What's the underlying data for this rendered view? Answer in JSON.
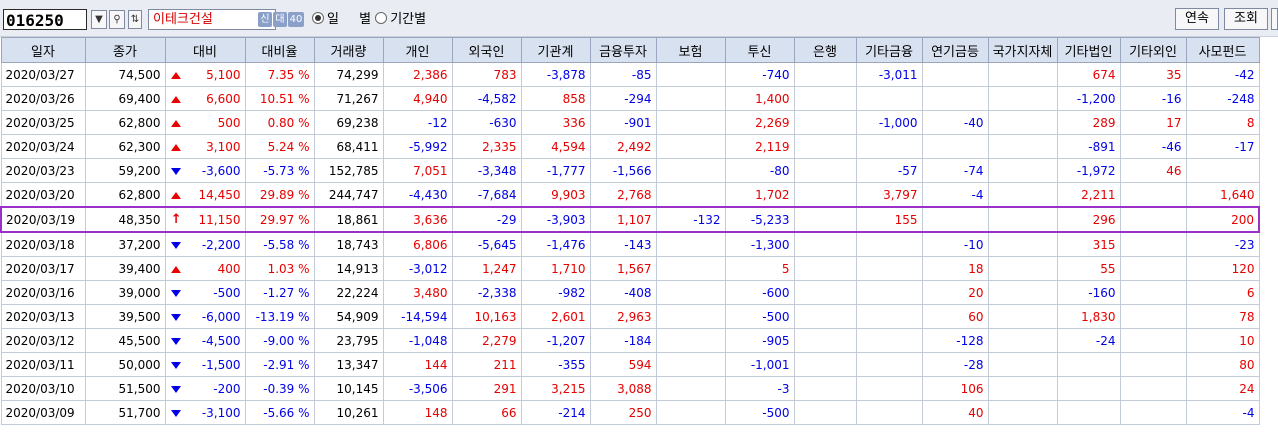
{
  "toolbar": {
    "stock_code": "016250",
    "stock_name": "이테크건설",
    "badge_credit": "신",
    "badge_loan": "대",
    "badge_margin": "40",
    "radio_daily": "일",
    "radio_separator": "별",
    "radio_period": "기간별",
    "continuous_label": "연속",
    "search_label": "조회"
  },
  "columns": [
    "일자",
    "종가",
    "대비",
    "대비율",
    "거래량",
    "개인",
    "외국인",
    "기관계",
    "금융투자",
    "보험",
    "투신",
    "은행",
    "기타금융",
    "연기금등",
    "국가지자체",
    "기타법인",
    "기타외인",
    "사모펀드"
  ],
  "colors": {
    "up": "#e60000",
    "down": "#0000e6",
    "selected_row_border": "#9b30c8",
    "header_bg": "#d8e1f0"
  },
  "rows": [
    {
      "date": "2020/03/27",
      "close": "74,500",
      "dir": "up",
      "chg": "5,100",
      "rate": "7.35 %",
      "vol": "74,299",
      "ind": "2,386",
      "frn": "783",
      "inst": "-3,878",
      "fin": "-85",
      "ins": "",
      "trust": "-740",
      "bank": "",
      "ofin": "-3,011",
      "pens": "",
      "gov": "",
      "ocorp": "674",
      "ofrn": "35",
      "pef": "-42"
    },
    {
      "date": "2020/03/26",
      "close": "69,400",
      "dir": "up",
      "chg": "6,600",
      "rate": "10.51 %",
      "vol": "71,267",
      "ind": "4,940",
      "frn": "-4,582",
      "inst": "858",
      "fin": "-294",
      "ins": "",
      "trust": "1,400",
      "bank": "",
      "ofin": "",
      "pens": "",
      "gov": "",
      "ocorp": "-1,200",
      "ofrn": "-16",
      "pef": "-248"
    },
    {
      "date": "2020/03/25",
      "close": "62,800",
      "dir": "up",
      "chg": "500",
      "rate": "0.80 %",
      "vol": "69,238",
      "ind": "-12",
      "frn": "-630",
      "inst": "336",
      "fin": "-901",
      "ins": "",
      "trust": "2,269",
      "bank": "",
      "ofin": "-1,000",
      "pens": "-40",
      "gov": "",
      "ocorp": "289",
      "ofrn": "17",
      "pef": "8"
    },
    {
      "date": "2020/03/24",
      "close": "62,300",
      "dir": "up",
      "chg": "3,100",
      "rate": "5.24 %",
      "vol": "68,411",
      "ind": "-5,992",
      "frn": "2,335",
      "inst": "4,594",
      "fin": "2,492",
      "ins": "",
      "trust": "2,119",
      "bank": "",
      "ofin": "",
      "pens": "",
      "gov": "",
      "ocorp": "-891",
      "ofrn": "-46",
      "pef": "-17"
    },
    {
      "date": "2020/03/23",
      "close": "59,200",
      "dir": "down",
      "chg": "-3,600",
      "rate": "-5.73 %",
      "vol": "152,785",
      "ind": "7,051",
      "frn": "-3,348",
      "inst": "-1,777",
      "fin": "-1,566",
      "ins": "",
      "trust": "-80",
      "bank": "",
      "ofin": "-57",
      "pens": "-74",
      "gov": "",
      "ocorp": "-1,972",
      "ofrn": "46",
      "pef": ""
    },
    {
      "date": "2020/03/20",
      "close": "62,800",
      "dir": "up",
      "chg": "14,450",
      "rate": "29.89 %",
      "vol": "244,747",
      "ind": "-4,430",
      "frn": "-7,684",
      "inst": "9,903",
      "fin": "2,768",
      "ins": "",
      "trust": "1,702",
      "bank": "",
      "ofin": "3,797",
      "pens": "-4",
      "gov": "",
      "ocorp": "2,211",
      "ofrn": "",
      "pef": "1,640"
    },
    {
      "date": "2020/03/19",
      "close": "48,350",
      "dir": "limit",
      "chg": "11,150",
      "rate": "29.97 %",
      "vol": "18,861",
      "ind": "3,636",
      "frn": "-29",
      "inst": "-3,903",
      "fin": "1,107",
      "ins": "-132",
      "trust": "-5,233",
      "bank": "",
      "ofin": "155",
      "pens": "",
      "gov": "",
      "ocorp": "296",
      "ofrn": "",
      "pef": "200",
      "selected": true
    },
    {
      "date": "2020/03/18",
      "close": "37,200",
      "dir": "down",
      "chg": "-2,200",
      "rate": "-5.58 %",
      "vol": "18,743",
      "ind": "6,806",
      "frn": "-5,645",
      "inst": "-1,476",
      "fin": "-143",
      "ins": "",
      "trust": "-1,300",
      "bank": "",
      "ofin": "",
      "pens": "-10",
      "gov": "",
      "ocorp": "315",
      "ofrn": "",
      "pef": "-23"
    },
    {
      "date": "2020/03/17",
      "close": "39,400",
      "dir": "up",
      "chg": "400",
      "rate": "1.03 %",
      "vol": "14,913",
      "ind": "-3,012",
      "frn": "1,247",
      "inst": "1,710",
      "fin": "1,567",
      "ins": "",
      "trust": "5",
      "bank": "",
      "ofin": "",
      "pens": "18",
      "gov": "",
      "ocorp": "55",
      "ofrn": "",
      "pef": "120"
    },
    {
      "date": "2020/03/16",
      "close": "39,000",
      "dir": "down",
      "chg": "-500",
      "rate": "-1.27 %",
      "vol": "22,224",
      "ind": "3,480",
      "frn": "-2,338",
      "inst": "-982",
      "fin": "-408",
      "ins": "",
      "trust": "-600",
      "bank": "",
      "ofin": "",
      "pens": "20",
      "gov": "",
      "ocorp": "-160",
      "ofrn": "",
      "pef": "6"
    },
    {
      "date": "2020/03/13",
      "close": "39,500",
      "dir": "down",
      "chg": "-6,000",
      "rate": "-13.19 %",
      "vol": "54,909",
      "ind": "-14,594",
      "frn": "10,163",
      "inst": "2,601",
      "fin": "2,963",
      "ins": "",
      "trust": "-500",
      "bank": "",
      "ofin": "",
      "pens": "60",
      "gov": "",
      "ocorp": "1,830",
      "ofrn": "",
      "pef": "78"
    },
    {
      "date": "2020/03/12",
      "close": "45,500",
      "dir": "down",
      "chg": "-4,500",
      "rate": "-9.00 %",
      "vol": "23,795",
      "ind": "-1,048",
      "frn": "2,279",
      "inst": "-1,207",
      "fin": "-184",
      "ins": "",
      "trust": "-905",
      "bank": "",
      "ofin": "",
      "pens": "-128",
      "gov": "",
      "ocorp": "-24",
      "ofrn": "",
      "pef": "10"
    },
    {
      "date": "2020/03/11",
      "close": "50,000",
      "dir": "down",
      "chg": "-1,500",
      "rate": "-2.91 %",
      "vol": "13,347",
      "ind": "144",
      "frn": "211",
      "inst": "-355",
      "fin": "594",
      "ins": "",
      "trust": "-1,001",
      "bank": "",
      "ofin": "",
      "pens": "-28",
      "gov": "",
      "ocorp": "",
      "ofrn": "",
      "pef": "80"
    },
    {
      "date": "2020/03/10",
      "close": "51,500",
      "dir": "down",
      "chg": "-200",
      "rate": "-0.39 %",
      "vol": "10,145",
      "ind": "-3,506",
      "frn": "291",
      "inst": "3,215",
      "fin": "3,088",
      "ins": "",
      "trust": "-3",
      "bank": "",
      "ofin": "",
      "pens": "106",
      "gov": "",
      "ocorp": "",
      "ofrn": "",
      "pef": "24"
    },
    {
      "date": "2020/03/09",
      "close": "51,700",
      "dir": "down",
      "chg": "-3,100",
      "rate": "-5.66 %",
      "vol": "10,261",
      "ind": "148",
      "frn": "66",
      "inst": "-214",
      "fin": "250",
      "ins": "",
      "trust": "-500",
      "bank": "",
      "ofin": "",
      "pens": "40",
      "gov": "",
      "ocorp": "",
      "ofrn": "",
      "pef": "-4"
    }
  ]
}
